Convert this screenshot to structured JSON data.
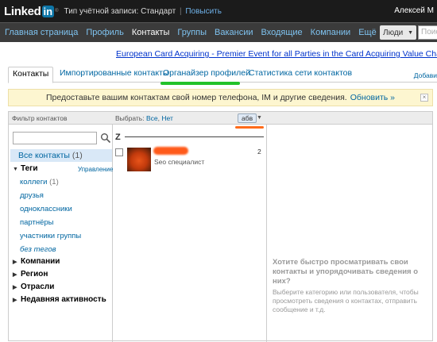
{
  "topbar": {
    "logo_text": "Linked",
    "logo_in": "in",
    "logo_reg": "®",
    "account_type": "Тип учётной записи: Стандарт",
    "separator": "|",
    "upgrade": "Повысить",
    "user_name": "Алексей М"
  },
  "nav": {
    "items": [
      {
        "label": "Главная страница"
      },
      {
        "label": "Профиль"
      },
      {
        "label": "Контакты"
      },
      {
        "label": "Группы"
      },
      {
        "label": "Вакансии"
      },
      {
        "label": "Входящие"
      },
      {
        "label": "Компании"
      },
      {
        "label": "Ещё"
      }
    ],
    "active": "Контакты",
    "people_label": "Люди",
    "people_arrow": "▼",
    "search_placeholder": "Поис"
  },
  "ad": {
    "text": "European Card Acquiring - Premier Event for all Parties in the Card Acquiring Value Chain"
  },
  "tabs": {
    "items": [
      {
        "label": "Контакты"
      },
      {
        "label": "Импортированные контакты"
      },
      {
        "label": "Органайзер профилей"
      },
      {
        "label": "Статистика сети контактов"
      }
    ],
    "active": "Контакты",
    "add_link": "Добави"
  },
  "notice": {
    "text": "Предоставьте вашим контактам свой номер телефона, IM и другие сведения.",
    "update_link": "Обновить »",
    "close": "×"
  },
  "panel": {
    "filter_title": "Фильтр контактов",
    "select_label": "Выбрать:",
    "select_all": "Все",
    "select_sep": ",",
    "select_none": "Нет",
    "sort_label": "абв",
    "sort_arrow": "▼"
  },
  "filters": {
    "all_contacts": "Все контакты",
    "all_count": "(1)",
    "tags_label": "Теги",
    "manage_link": "Управление",
    "tags": [
      {
        "label": "коллеги",
        "count": "(1)"
      },
      {
        "label": "друзья",
        "count": ""
      },
      {
        "label": "одноклассники",
        "count": ""
      },
      {
        "label": "партнёры",
        "count": ""
      },
      {
        "label": "участники группы",
        "count": ""
      },
      {
        "label": "без тегов",
        "count": ""
      }
    ],
    "categories": [
      {
        "label": "Компании"
      },
      {
        "label": "Регион"
      },
      {
        "label": "Отрасли"
      },
      {
        "label": "Недавняя активность"
      }
    ],
    "expanded_marker": "▼",
    "collapsed_marker": "▶"
  },
  "contacts": {
    "letter": "Z",
    "items": [
      {
        "title": "Seo специалист",
        "count": "2"
      }
    ]
  },
  "help": {
    "title": "Хотите быстро просматривать свои контакты и упорядочивать сведения о них?",
    "body": "Выберите категорию или пользователя, чтобы просмотреть сведения о контактах, отправить сообщение и т.д."
  },
  "colors": {
    "brand": "#0e76a8",
    "highlight_green": "#22c22a",
    "highlight_orange": "#ff6b1a"
  }
}
